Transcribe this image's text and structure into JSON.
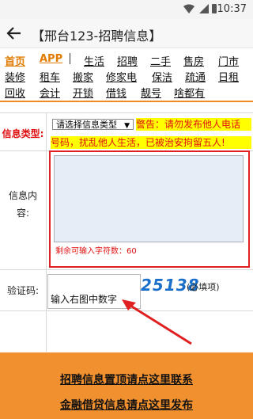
{
  "status": {
    "time": "10:37"
  },
  "appbar": {
    "title": "【邢台123-招聘信息】"
  },
  "nav": {
    "row1": [
      "首页",
      "APP",
      "生活",
      "招聘",
      "二手",
      "售房",
      "门市"
    ],
    "row2": [
      "装修",
      "租车",
      "搬家",
      "修家电",
      "保洁",
      "疏通",
      "日租"
    ],
    "row3": [
      "回收",
      "会计",
      "开锁",
      "借钱",
      "靓号",
      "啥都有"
    ]
  },
  "form": {
    "type_label": "信息类型:",
    "type_select": "请选择信息类型",
    "warning_line1": "警告：请勿发布他人电话",
    "warning_line2": "号码，扰乱他人生活，已被治安拘留五人!",
    "content_label_line1": "信息内",
    "content_label_line2": "容:",
    "remaining": "剩余可输入字符数：60",
    "captcha_label": "验证码:",
    "captcha_placeholder": "输入右图中数字",
    "captcha_value": "25138",
    "required_note": "(必填项)"
  },
  "bottom": {
    "link1": "招聘信息置顶请点这里联系",
    "link2": "金融借贷信息请点这里发布"
  },
  "colors": {
    "accent": "#f0902e",
    "warning_bg": "#ffff00",
    "warning_text": "#e01010",
    "captcha": "#1a6fc9"
  }
}
